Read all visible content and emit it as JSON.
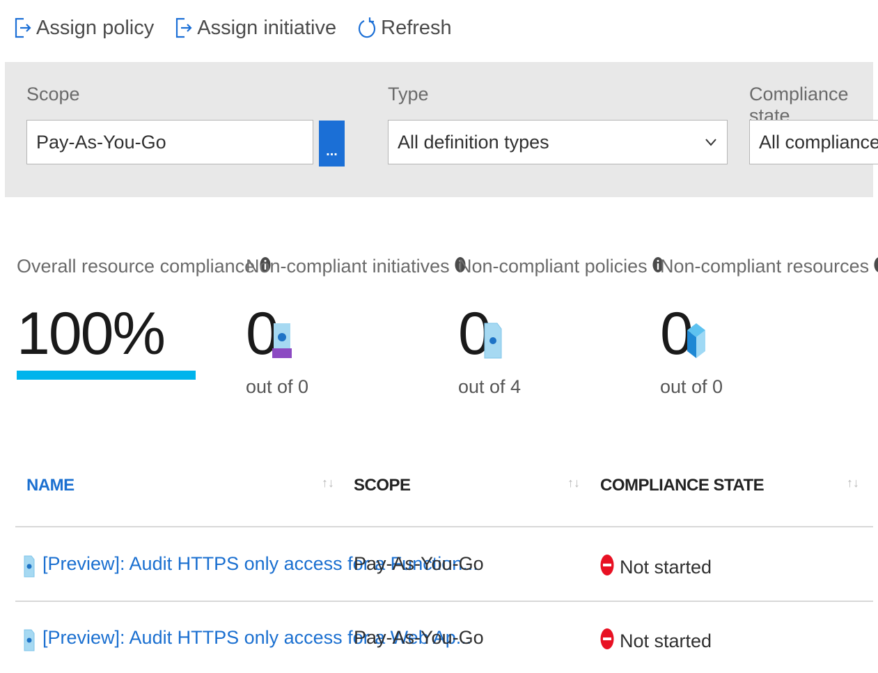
{
  "toolbar": {
    "assign_policy": "Assign policy",
    "assign_initiative": "Assign initiative",
    "refresh": "Refresh"
  },
  "filters": {
    "scope_label": "Scope",
    "scope_value": "Pay-As-You-Go",
    "scope_button": "...",
    "type_label": "Type",
    "type_value": "All definition types",
    "compliance_label": "Compliance state",
    "compliance_value": "All compliance state"
  },
  "stats": {
    "overall": {
      "label": "Overall resource compliance",
      "value": "100%",
      "fraction": 1.0
    },
    "initiatives": {
      "label": "Non-compliant initiatives",
      "value": "0",
      "out_of": "out of 0"
    },
    "policies": {
      "label": "Non-compliant policies",
      "value": "0",
      "out_of": "out of 4"
    },
    "resources": {
      "label": "Non-compliant resources",
      "value": "0",
      "out_of": "out of 0"
    }
  },
  "table": {
    "headers": {
      "name": "NAME",
      "scope": "SCOPE",
      "compliance": "COMPLIANCE STATE"
    },
    "rows": [
      {
        "name": "[Preview]: Audit HTTPS only access for a Function...",
        "scope": "Pay-As-You-Go",
        "state": "Not started"
      },
      {
        "name": "[Preview]: Audit HTTPS only access for a Web Ap...",
        "scope": "Pay-As-You-Go",
        "state": "Not started"
      }
    ]
  },
  "colors": {
    "accent": "#1b6fd6",
    "link": "#1a6fd0",
    "compliance_bar": "#00b4ec",
    "status_error": "#e81123",
    "panel_bg": "#e8e8e8"
  },
  "icons": {
    "assign_policy": "assign-icon",
    "assign_initiative": "assign-icon",
    "refresh": "refresh-icon",
    "info": "info-icon",
    "initiative": "initiative-icon",
    "policy": "policy-document-icon",
    "resource": "cube-icon",
    "sort": "sort-icon",
    "not_started": "blocked-icon"
  }
}
